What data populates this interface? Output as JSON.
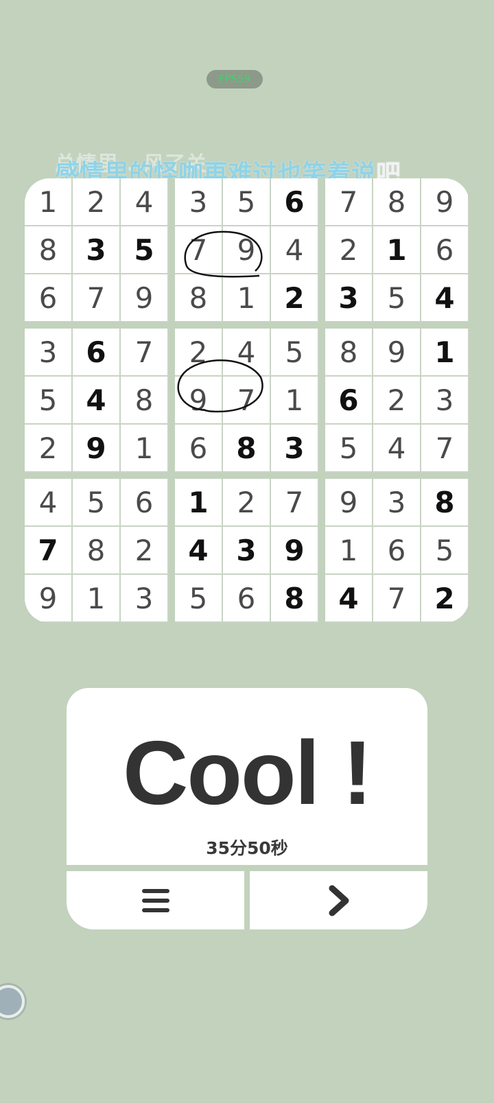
{
  "fps": {
    "label": "FPS59"
  },
  "lyrics": {
    "previous_line": "总情里 ..风了关",
    "current_main": "感情里的怪咖再难过也笑着说",
    "current_tail": "吧"
  },
  "board": {
    "rows": [
      [
        1,
        2,
        4,
        3,
        5,
        6,
        7,
        8,
        9
      ],
      [
        8,
        3,
        5,
        7,
        9,
        4,
        2,
        1,
        6
      ],
      [
        6,
        7,
        9,
        8,
        1,
        2,
        3,
        5,
        4
      ],
      [
        3,
        6,
        7,
        2,
        4,
        5,
        8,
        9,
        1
      ],
      [
        5,
        4,
        8,
        9,
        7,
        1,
        6,
        2,
        3
      ],
      [
        2,
        9,
        1,
        6,
        8,
        3,
        5,
        4,
        7
      ],
      [
        4,
        5,
        6,
        1,
        2,
        7,
        9,
        3,
        8
      ],
      [
        7,
        8,
        2,
        4,
        3,
        9,
        1,
        6,
        5
      ],
      [
        9,
        1,
        3,
        5,
        6,
        8,
        4,
        7,
        2
      ]
    ],
    "givens": [
      [
        0,
        0,
        0,
        0,
        0,
        1,
        0,
        0,
        0
      ],
      [
        0,
        1,
        1,
        0,
        0,
        0,
        0,
        1,
        0
      ],
      [
        0,
        0,
        0,
        0,
        0,
        1,
        1,
        0,
        1
      ],
      [
        0,
        1,
        0,
        0,
        0,
        0,
        0,
        0,
        1
      ],
      [
        0,
        1,
        0,
        0,
        0,
        0,
        1,
        0,
        0
      ],
      [
        0,
        1,
        0,
        0,
        1,
        1,
        0,
        0,
        0
      ],
      [
        0,
        0,
        0,
        1,
        0,
        0,
        0,
        0,
        1
      ],
      [
        1,
        0,
        0,
        1,
        1,
        1,
        0,
        0,
        0
      ],
      [
        0,
        0,
        0,
        0,
        0,
        1,
        1,
        0,
        1
      ]
    ],
    "circled_pairs": [
      {
        "row": 1,
        "cols": [
          3,
          4
        ]
      },
      {
        "row": 4,
        "cols": [
          3,
          4
        ]
      }
    ]
  },
  "result": {
    "title": "Cool !",
    "elapsed": "35分50秒"
  },
  "buttons": {
    "menu_icon": "hamburger-menu-icon",
    "next_icon": "chevron-right-icon"
  },
  "colors": {
    "background": "#c2d2bd",
    "cell": "#ffffff",
    "given_digit": "#111111",
    "filled_digit": "#4a4a4a",
    "fps_text": "#3fd36a",
    "lyric": "#8fd3e8"
  }
}
